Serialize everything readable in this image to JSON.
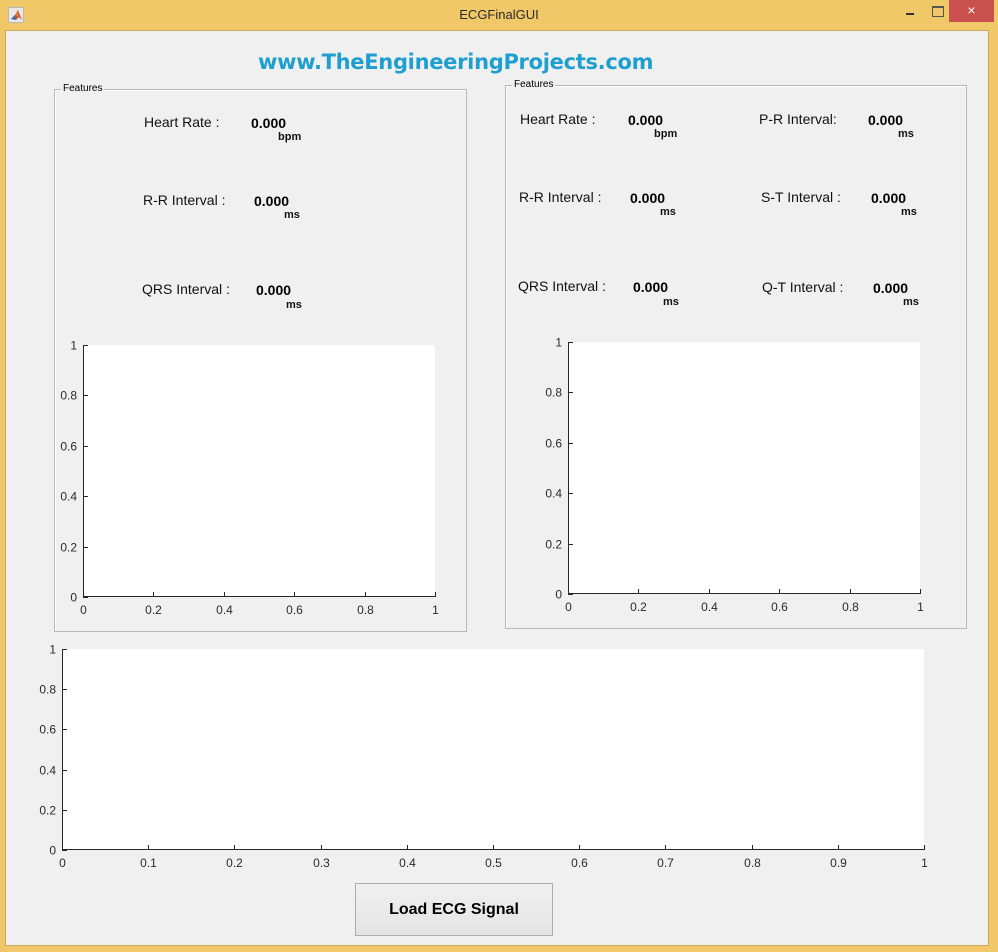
{
  "window": {
    "title": "ECGFinalGUI",
    "icon": "matlab-icon",
    "controls": {
      "minimize": "minimize-icon",
      "maximize": "maximize-icon",
      "close": "×"
    }
  },
  "brand_text": "www.TheEngineeringProjects.com",
  "left_panel": {
    "title": "Features",
    "features": [
      {
        "label": "Heart Rate :",
        "value": "0.000",
        "unit": "bpm"
      },
      {
        "label": "R-R Interval :",
        "value": "0.000",
        "unit": "ms"
      },
      {
        "label": "QRS Interval :",
        "value": "0.000",
        "unit": "ms"
      }
    ]
  },
  "right_panel": {
    "title": "Features",
    "features": [
      {
        "label": "Heart Rate :",
        "value": "0.000",
        "unit": "bpm"
      },
      {
        "label": "P-R Interval:",
        "value": "0.000",
        "unit": "ms"
      },
      {
        "label": "R-R Interval :",
        "value": "0.000",
        "unit": "ms"
      },
      {
        "label": "S-T Interval :",
        "value": "0.000",
        "unit": "ms"
      },
      {
        "label": "QRS Interval :",
        "value": "0.000",
        "unit": "ms"
      },
      {
        "label": "Q-T Interval :",
        "value": "0.000",
        "unit": "ms"
      }
    ]
  },
  "load_button_label": "Load ECG Signal",
  "chart_data": [
    {
      "id": "left-axes",
      "type": "line",
      "title": "",
      "xlabel": "",
      "ylabel": "",
      "series": [],
      "xlim": [
        0,
        1
      ],
      "ylim": [
        0,
        1
      ],
      "xticks": [
        "0",
        "0.2",
        "0.4",
        "0.6",
        "0.8",
        "1"
      ],
      "yticks": [
        "0",
        "0.2",
        "0.4",
        "0.6",
        "0.8",
        "1"
      ],
      "grid": false
    },
    {
      "id": "right-axes",
      "type": "line",
      "title": "",
      "xlabel": "",
      "ylabel": "",
      "series": [],
      "xlim": [
        0,
        1
      ],
      "ylim": [
        0,
        1
      ],
      "xticks": [
        "0",
        "0.2",
        "0.4",
        "0.6",
        "0.8",
        "1"
      ],
      "yticks": [
        "0",
        "0.2",
        "0.4",
        "0.6",
        "0.8",
        "1"
      ],
      "grid": false
    },
    {
      "id": "bottom-axes",
      "type": "line",
      "title": "",
      "xlabel": "",
      "ylabel": "",
      "series": [],
      "xlim": [
        0,
        1
      ],
      "ylim": [
        0,
        1
      ],
      "xticks": [
        "0",
        "0.1",
        "0.2",
        "0.3",
        "0.4",
        "0.5",
        "0.6",
        "0.7",
        "0.8",
        "0.9",
        "1"
      ],
      "yticks": [
        "0",
        "0.2",
        "0.4",
        "0.6",
        "0.8",
        "1"
      ],
      "grid": false
    }
  ]
}
